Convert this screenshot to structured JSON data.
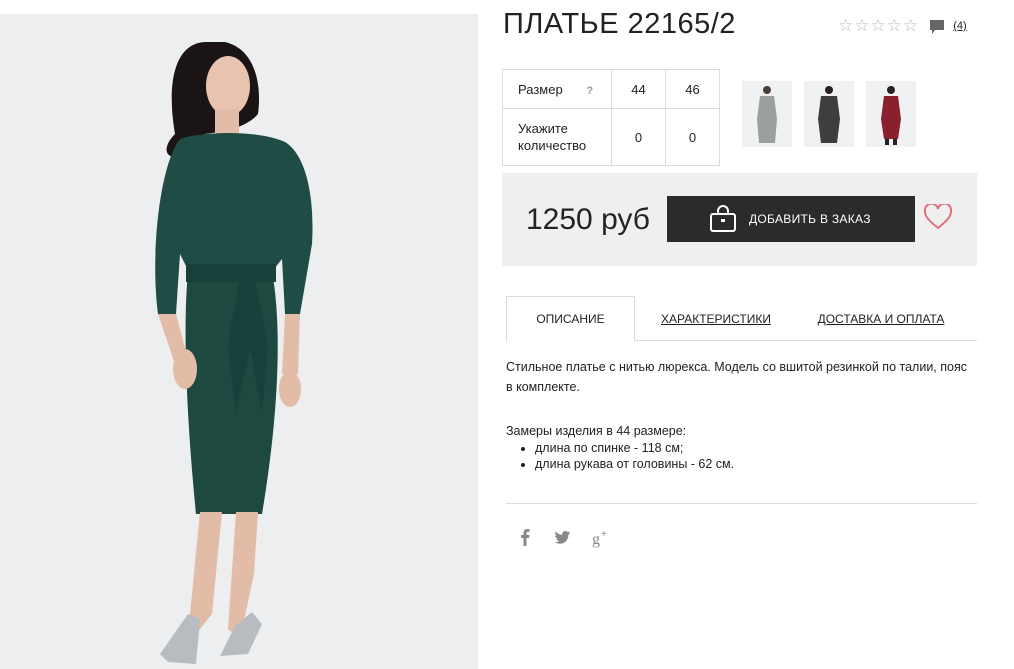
{
  "product": {
    "title": "ПЛАТЬЕ 22165/2",
    "reviews_count": "(4)",
    "rating_stars": 0,
    "price": "1250 руб",
    "add_to_order_label": "ДОБАВИТЬ В ЗАКАЗ"
  },
  "size_table": {
    "size_label": "Размер",
    "help_mark": "?",
    "sizes": [
      "44",
      "46"
    ],
    "qty_label": "Укажите количество",
    "quantities": [
      "0",
      "0"
    ]
  },
  "thumbnails": [
    {
      "name": "thumb-light-grey-dress",
      "color": "#9aa0a0"
    },
    {
      "name": "thumb-dark-grey-dress",
      "color": "#3c3e40"
    },
    {
      "name": "thumb-burgundy-dress",
      "color": "#8a1f2e"
    }
  ],
  "tabs": [
    {
      "label": "ОПИСАНИЕ",
      "active": true
    },
    {
      "label": "ХАРАКТЕРИСТИКИ",
      "active": false
    },
    {
      "label": "ДОСТАВКА И ОПЛАТА",
      "active": false
    }
  ],
  "description": {
    "text": "Стильное платье с нитью люрекса. Модель со вшитой резинкой по талии, пояс в комплекте.",
    "measure_title": "Замеры изделия в 44 размере:",
    "measures": [
      "длина по спинке - 118 см;",
      "длина рукава от головины - 62 см."
    ]
  },
  "social": [
    "facebook-icon",
    "twitter-icon",
    "google-plus-icon"
  ],
  "colors": {
    "dress": "#1f4d45",
    "button": "#2b2b2b",
    "heart": "#e07080",
    "price_box": "#efefef"
  }
}
